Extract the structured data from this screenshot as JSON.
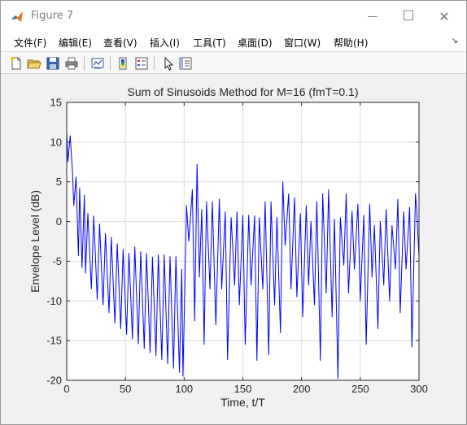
{
  "window": {
    "title": "Figure 7",
    "minimize_glyph": "—",
    "maximize_glyph": "☐",
    "close_glyph": "✕"
  },
  "menu": {
    "items": [
      "文件(F)",
      "编辑(E)",
      "查看(V)",
      "插入(I)",
      "工具(T)",
      "桌面(D)",
      "窗口(W)",
      "帮助(H)"
    ],
    "overflow_glyph": "↘"
  },
  "toolbar": {
    "icons": [
      "new-figure-icon",
      "open-file-icon",
      "save-icon",
      "print-icon",
      "link-plot-icon",
      "colorbar-icon",
      "legend-icon",
      "pointer-icon",
      "property-inspector-icon"
    ]
  },
  "colors": {
    "line": "#0000ff",
    "grid": "#dcdcdc",
    "axes_bg": "#ffffff",
    "figure_bg": "#f0f0f0"
  },
  "chart_data": {
    "type": "line",
    "title": "Sum of Sinusoids Method for M=16 (fmT=0.1)",
    "xlabel": "Time, t/T",
    "ylabel": "Envelope Level (dB)",
    "xlim": [
      0,
      300
    ],
    "ylim": [
      -20,
      15
    ],
    "xticks": [
      0,
      50,
      100,
      150,
      200,
      250,
      300
    ],
    "yticks": [
      -20,
      -15,
      -10,
      -5,
      0,
      5,
      10,
      15
    ],
    "xtick_labels": [
      "0",
      "50",
      "100",
      "150",
      "200",
      "250",
      "300"
    ],
    "ytick_labels": [
      "-20",
      "-15",
      "-10",
      "-5",
      "0",
      "5",
      "10",
      "15"
    ],
    "grid": true,
    "series": [
      {
        "color": "#0000ff",
        "x": [
          0,
          1,
          3,
          5,
          6,
          8,
          10,
          11,
          13,
          15,
          16,
          18,
          21,
          23,
          26,
          28,
          31,
          33,
          36,
          38,
          41,
          43,
          46,
          48,
          51,
          53,
          56,
          58,
          61,
          63,
          66,
          68,
          71,
          73,
          76,
          78,
          81,
          83,
          86,
          88,
          91,
          93,
          96,
          98,
          99,
          102,
          104,
          107,
          109,
          111,
          113,
          115,
          117,
          119,
          122,
          124,
          127,
          130,
          132,
          135,
          137,
          140,
          143,
          145,
          147,
          150,
          152,
          155,
          157,
          160,
          162,
          164,
          167,
          169,
          172,
          174,
          177,
          179,
          182,
          184,
          186,
          189,
          191,
          194,
          196,
          199,
          201,
          204,
          206,
          208,
          211,
          213,
          216,
          218,
          221,
          223,
          226,
          228,
          231,
          233,
          236,
          238,
          240,
          243,
          245,
          248,
          250,
          253,
          255,
          258,
          260,
          262,
          265,
          267,
          270,
          272,
          275,
          277,
          280,
          282,
          284,
          287,
          289,
          292,
          294,
          297,
          298,
          300
        ],
        "y": [
          11.5,
          7.5,
          10.8,
          6.0,
          2.0,
          5.6,
          -4.3,
          4.2,
          -5.8,
          3.3,
          -6.5,
          1.0,
          -8.5,
          0.7,
          -9.8,
          -0.3,
          -10.5,
          -1.5,
          -11.5,
          -2.0,
          -12.8,
          -2.8,
          -13.5,
          -3.5,
          -14.2,
          -4.0,
          -14.8,
          -3.2,
          -15.4,
          -3.8,
          -16.0,
          -4.0,
          -16.5,
          -4.5,
          -16.9,
          -4.2,
          -17.4,
          -4.2,
          -17.9,
          -4.4,
          -18.5,
          -4.4,
          -19.0,
          -6.0,
          -19.5,
          2.0,
          -2.5,
          4.0,
          -12.5,
          7.2,
          -7.0,
          1.5,
          -15.5,
          2.5,
          -8.5,
          2.5,
          -13.0,
          2.8,
          -8.5,
          1.2,
          -17.4,
          0.5,
          -8.0,
          1.2,
          -10.5,
          0.8,
          -15.5,
          0.8,
          -8.0,
          0.7,
          -17.5,
          0.5,
          -8.5,
          2.5,
          -16.8,
          2.5,
          -10.5,
          0.5,
          -14.0,
          5.0,
          -3.0,
          3.5,
          -8.5,
          3.0,
          -9.5,
          1.0,
          -12.0,
          2.0,
          -8.0,
          0.0,
          -10.5,
          2.5,
          -17.5,
          3.5,
          -9.0,
          4.0,
          -12.0,
          0.3,
          -19.8,
          0.5,
          -5.5,
          3.5,
          -9.0,
          1.3,
          -6.0,
          2.2,
          -10.0,
          0.8,
          -15.5,
          2.2,
          -7.0,
          -0.5,
          -13.5,
          0.0,
          -8.0,
          1.5,
          -10.0,
          -0.5,
          -6.0,
          2.8,
          -11.5,
          1.2,
          -6.0,
          1.8,
          -15.8,
          3.5,
          1.5,
          -4.5
        ]
      }
    ]
  }
}
